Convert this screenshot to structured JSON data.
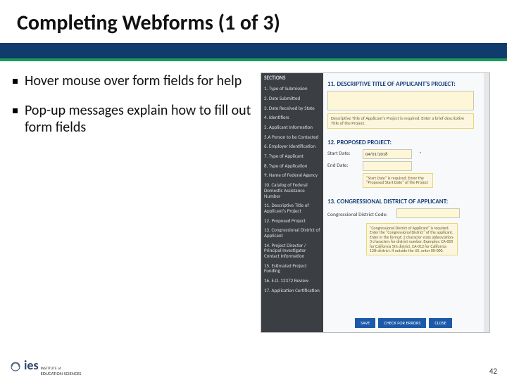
{
  "title": "Completing Webforms (1 of 3)",
  "bullets": [
    "Hover mouse over form fields for help",
    "Pop-up messages explain how to fill out form fields"
  ],
  "sidebar": {
    "header": "SECTIONS",
    "items": [
      "1. Type of Submission",
      "2. Date Submitted",
      "3. Date Received by State",
      "4. Identifiers",
      "5. Applicant Information",
      "5.A Person to be Contacted",
      "6. Employer Identification",
      "7. Type of Applicant",
      "8. Type of Application",
      "9. Name of Federal Agency",
      "10. Catalog of Federal Domestic Assistance Number",
      "11. Descriptive Title of Applicant's Project",
      "12. Proposed Project",
      "13. Congressional District of Applicant",
      "14. Project Director / Principal Investigator Contact Information",
      "15. Estimated Project Funding",
      "16. E.O. 12372 Review",
      "17. Application Certification"
    ]
  },
  "form": {
    "section11": {
      "heading": "11. DESCRIPTIVE TITLE OF APPLICANT'S PROJECT:",
      "tooltip": "Descriptive Title of Applicant's Project is required. Enter a brief descriptive Title of the Project."
    },
    "section12": {
      "heading": "12. PROPOSED PROJECT:",
      "start_label": "Start Date:",
      "start_value": "04/01/2018",
      "end_label": "End Date:",
      "tooltip": "\"Start Date\" is required. Enter the \"Proposed Start Date\" of the Project"
    },
    "section13": {
      "heading": "13. CONGRESSIONAL DISTRICT OF APPLICANT:",
      "label": "Congressional District Code:",
      "tooltip": "\"Congressional District of Applicant\" is required. Enter the \"Congressional District\" of the applicant. Enter in the format: 2 character state abbreviation-3 characters for district number. Examples: CA-005 for California 5th district, CA-012 for California 12th district. If outside the US, enter 00-000."
    },
    "buttons": {
      "save": "SAVE",
      "check": "CHECK FOR ERRORS",
      "close": "CLOSE"
    }
  },
  "logo": {
    "brand": "ies",
    "sub1": "INSTITUTE of",
    "sub2": "EDUCATION SCIENCES"
  },
  "page_number": "42"
}
